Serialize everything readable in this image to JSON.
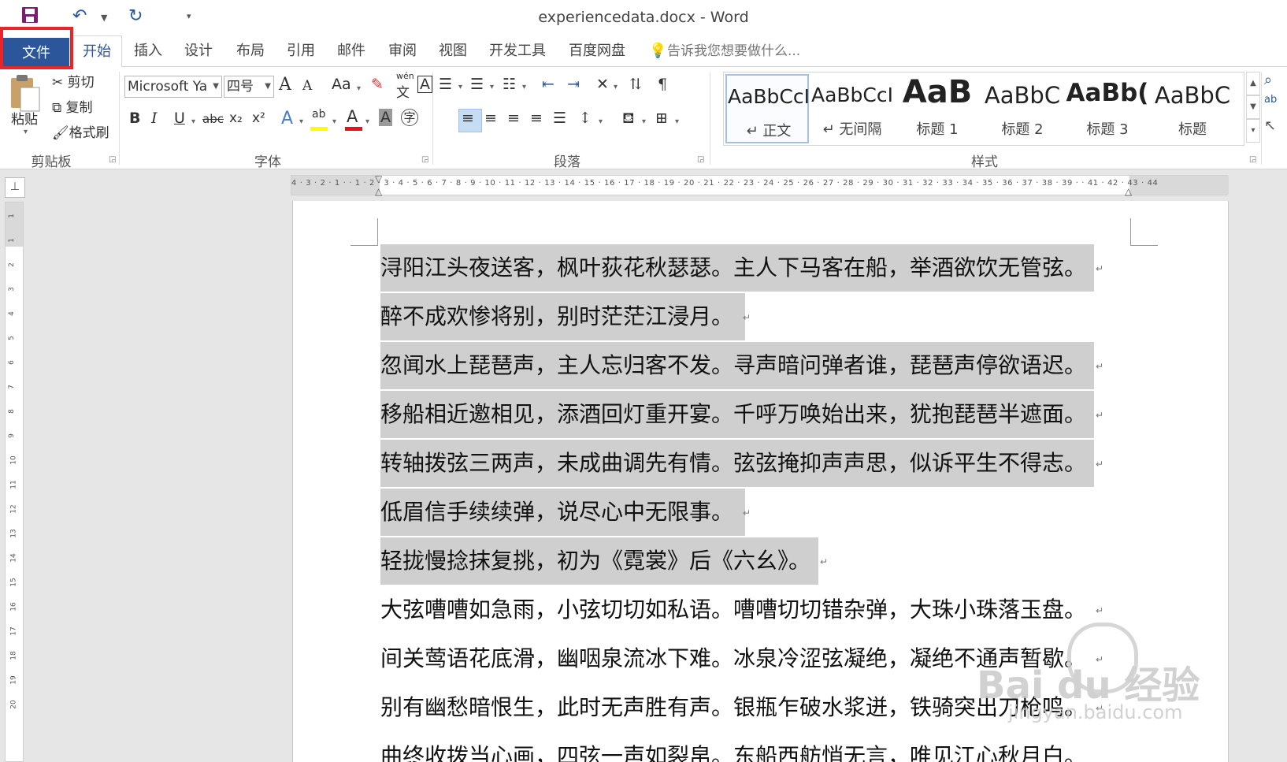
{
  "window": {
    "title": "experiencedata.docx - Word"
  },
  "quick_access": {
    "save_icon": "save-icon",
    "undo_icon": "undo-icon",
    "redo_icon": "redo-icon",
    "customize_icon": "customize-quick-access-icon"
  },
  "tabs": [
    {
      "label": "文件"
    },
    {
      "label": "开始"
    },
    {
      "label": "插入"
    },
    {
      "label": "设计"
    },
    {
      "label": "布局"
    },
    {
      "label": "引用"
    },
    {
      "label": "邮件"
    },
    {
      "label": "审阅"
    },
    {
      "label": "视图"
    },
    {
      "label": "开发工具"
    },
    {
      "label": "百度网盘"
    }
  ],
  "tell_me": {
    "placeholder": "告诉我您想要做什么..."
  },
  "clipboard": {
    "paste": "粘贴",
    "cut": "剪切",
    "copy": "复制",
    "format_painter": "格式刷",
    "label": "剪贴板"
  },
  "font": {
    "family": "Microsoft Ya",
    "size": "四号",
    "label": "字体",
    "case_button": "Aa",
    "phonetic_top": "wén",
    "phonetic_bottom": "文",
    "border_char": "A",
    "bold": "B",
    "italic": "I",
    "underline": "U",
    "strike": "abc",
    "subscript": "x₂",
    "superscript": "x²",
    "text_effect": "A",
    "highlight": "ab",
    "font_color": "A",
    "char_shading": "A",
    "enclose": "字",
    "grow": "A",
    "shrink": "A",
    "highlight_color": "#ffff00",
    "font_color_value": "#e81123"
  },
  "paragraph": {
    "label": "段落"
  },
  "styles": {
    "label": "样式",
    "items": [
      {
        "sample": "AaBbCcI",
        "name": "↵ 正文"
      },
      {
        "sample": "AaBbCcI",
        "name": "↵ 无间隔"
      },
      {
        "sample": "AaB",
        "name": "标题 1"
      },
      {
        "sample": "AaBbC",
        "name": "标题 2"
      },
      {
        "sample": "AaBb(",
        "name": "标题 3"
      },
      {
        "sample": "AaBbC",
        "name": "标题"
      }
    ]
  },
  "ruler": {
    "ticks": "4 · 3 · 2 · 1 ·   · 1 · 2 · 3 · 4 · 5 · 6 · 7 · 8 · 9 · 10 · 11 · 12 · 13 · 14 · 15 · 16 · 17 · 18 · 19 · 20 · 21 · 22 · 23 · 24 · 25 · 26 · 27 · 28 · 29 · 30 · 31 · 32 · 33 · 34 · 35 · 36 · 37 · 38 · 39 ·   · 41 · 42 · 43 · 44",
    "vticks": [
      "1",
      "1",
      "2",
      "3",
      "4",
      "5",
      "6",
      "7",
      "8",
      "9",
      "10",
      "11",
      "12",
      "13",
      "14",
      "15",
      "16",
      "17",
      "18",
      "19",
      "20"
    ]
  },
  "document": {
    "lines": [
      {
        "text": "浔阳江头夜送客，枫叶荻花秋瑟瑟。主人下马客在船，举酒欲饮无管弦。",
        "selected": true
      },
      {
        "text": "醉不成欢惨将别，别时茫茫江浸月。",
        "selected": true
      },
      {
        "text": "忽闻水上琵琶声，主人忘归客不发。寻声暗问弹者谁，琵琶声停欲语迟。",
        "selected": true
      },
      {
        "text": "移船相近邀相见，添酒回灯重开宴。千呼万唤始出来，犹抱琵琶半遮面。",
        "selected": true
      },
      {
        "text": "转轴拨弦三两声，未成曲调先有情。弦弦掩抑声声思，似诉平生不得志。",
        "selected": true
      },
      {
        "text": "低眉信手续续弹，说尽心中无限事。",
        "selected": true
      },
      {
        "text": "轻拢慢捻抹复挑，初为《霓裳》后《六幺》。",
        "selected": true
      },
      {
        "text": "大弦嘈嘈如急雨，小弦切切如私语。嘈嘈切切错杂弹，大珠小珠落玉盘。",
        "selected": false
      },
      {
        "text": "间关莺语花底滑，幽咽泉流冰下难。冰泉冷涩弦凝绝，凝绝不通声暂歇。",
        "selected": false
      },
      {
        "text": "别有幽愁暗恨生，此时无声胜有声。银瓶乍破水浆迸，铁骑突出刀枪鸣。",
        "selected": false
      },
      {
        "text": "曲终收拨当心画，四弦一声如裂帛。东船西舫悄无言，唯见江心秋月白。",
        "selected": false
      }
    ],
    "paragraph_mark": "↵"
  },
  "watermark": {
    "text": "Bai du 经验",
    "url": "jingyan.baidu.com"
  },
  "colors": {
    "accent": "#2b579a",
    "highlight_box": "#e8262a",
    "selection": "#cfcfcf"
  }
}
